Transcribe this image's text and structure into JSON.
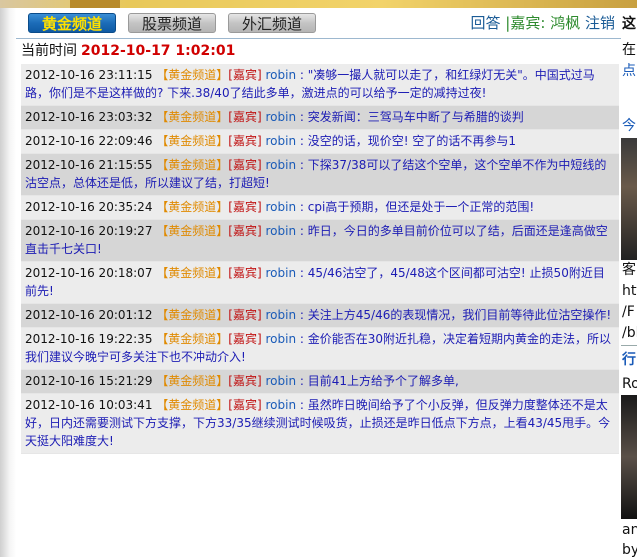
{
  "tabs": [
    {
      "label": "黄金频道",
      "active": true
    },
    {
      "label": "股票频道",
      "active": false
    },
    {
      "label": "外汇频道",
      "active": false
    }
  ],
  "top_links": {
    "answer": "回答",
    "guest_prefix": "|嘉宾:",
    "guest_name": "鸿枫",
    "logout": "注销"
  },
  "current_time": {
    "label": "当前时间",
    "value": "2012-10-17 1:02:01"
  },
  "messages": [
    {
      "time": "2012-10-16 23:11:15",
      "channel": "【黄金频道】",
      "guest_tag": "[嘉宾]",
      "user": "robin",
      "text": ": \"凑够一撮人就可以走了，和红绿灯无关\"。中国式过马路，你们是不是这样做的? 下来.38/40了结此多单，激进点的可以给予一定的减持过夜!"
    },
    {
      "time": "2012-10-16 23:03:32",
      "channel": "【黄金频道】",
      "guest_tag": "[嘉宾]",
      "user": "robin",
      "text": ": 突发新闻：三驾马车中断了与希腊的谈判"
    },
    {
      "time": "2012-10-16 22:09:46",
      "channel": "【黄金频道】",
      "guest_tag": "[嘉宾]",
      "user": "robin",
      "text": ": 没空的话，现价空!  空了的话不再参与1"
    },
    {
      "time": "2012-10-16 21:15:55",
      "channel": "【黄金频道】",
      "guest_tag": "[嘉宾]",
      "user": "robin",
      "text": ": 下探37/38可以了结这个空单，这个空单不作为中短线的沽空点，总体还是低，所以建议了结，打超短!"
    },
    {
      "time": "2012-10-16 20:35:24",
      "channel": "【黄金频道】",
      "guest_tag": "[嘉宾]",
      "user": "robin",
      "text": ": cpi高于预期，但还是处于一个正常的范围!"
    },
    {
      "time": "2012-10-16 20:19:27",
      "channel": "【黄金频道】",
      "guest_tag": "[嘉宾]",
      "user": "robin",
      "text": ": 昨日，今日的多单目前价位可以了结，后面还是逢高做空直击千七关口!"
    },
    {
      "time": "2012-10-16 20:18:07",
      "channel": "【黄金频道】",
      "guest_tag": "[嘉宾]",
      "user": "robin",
      "text": ": 45/46沽空了，45/48这个区间都可沽空! 止损50附近目前先!"
    },
    {
      "time": "2012-10-16 20:01:12",
      "channel": "【黄金频道】",
      "guest_tag": "[嘉宾]",
      "user": "robin",
      "text": ": 关注上方45/46的表现情况，我们目前等待此位沽空操作!"
    },
    {
      "time": "2012-10-16 19:22:35",
      "channel": "【黄金频道】",
      "guest_tag": "[嘉宾]",
      "user": "robin",
      "text": ": 金价能否在30附近扎稳，决定着短期内黄金的走法，所以我们建议今晚宁可多关注下也不冲动介入!"
    },
    {
      "time": "2012-10-16 15:21:29",
      "channel": "【黄金频道】",
      "guest_tag": "[嘉宾]",
      "user": "robin",
      "text": ": 目前41上方给予个了解多单,"
    },
    {
      "time": "2012-10-16 10:03:41",
      "channel": "【黄金频道】",
      "guest_tag": "[嘉宾]",
      "user": "robin",
      "text": ": 虽然昨日晚间给予了个小反弹，但反弹力度整体还不是太好，日内还需要测试下方支撑，下方33/35继续测试时候吸货，止损还是昨日低点下方点，上看43/45甩手。今天挺大阳难度大!"
    }
  ],
  "right_panel": {
    "fragments": [
      "这",
      "在",
      "点",
      "今",
      "客",
      "htt",
      "/F",
      "/bl",
      "行",
      "Ro",
      "an",
      "by"
    ]
  }
}
